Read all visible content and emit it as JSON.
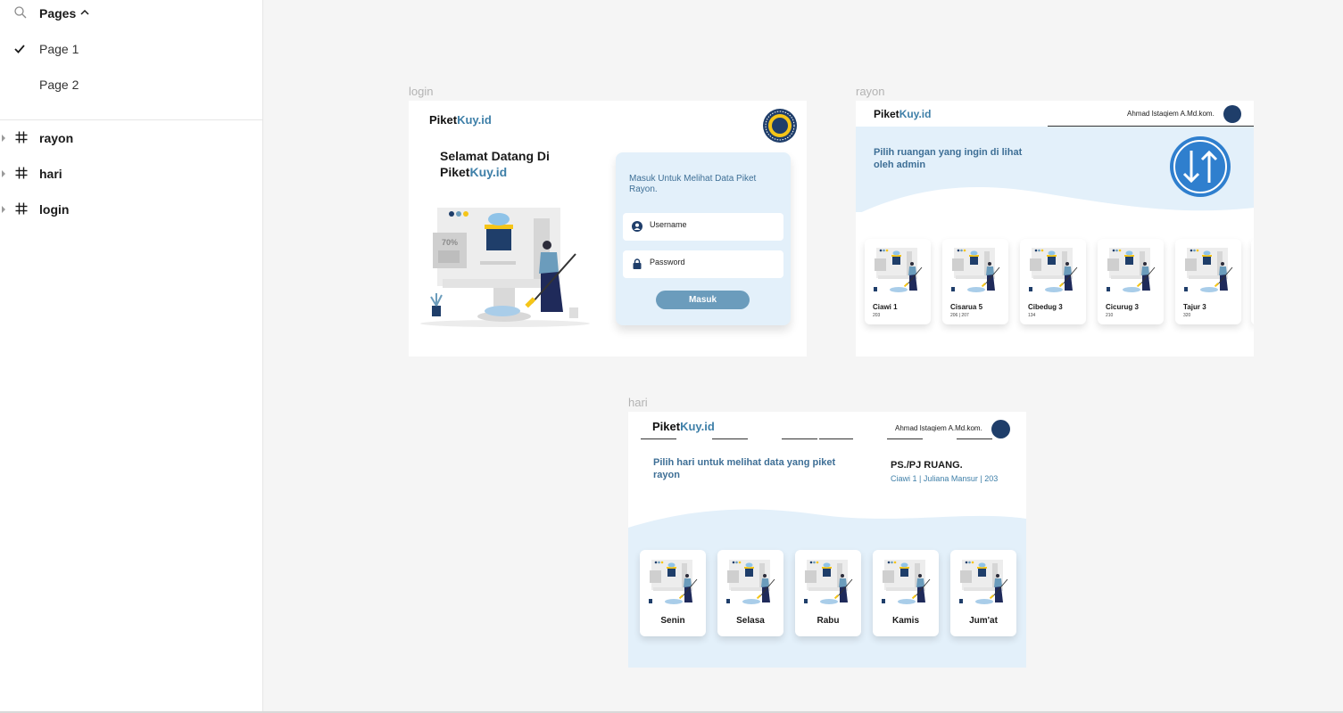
{
  "sidebar": {
    "pages_title": "Pages",
    "pages": [
      {
        "label": "Page 1",
        "selected": true
      },
      {
        "label": "Page 2",
        "selected": false
      }
    ],
    "layers": [
      {
        "label": "rayon"
      },
      {
        "label": "hari"
      },
      {
        "label": "login"
      }
    ]
  },
  "frames": {
    "login": {
      "label": "login",
      "brand_main": "Piket",
      "brand_accent": "Kuy.id",
      "welcome_line1": "Selamat Datang Di",
      "welcome_brand_main": "Piket",
      "welcome_brand_accent": "Kuy.id",
      "card_title": "Masuk Untuk Melihat Data Piket Rayon.",
      "username_placeholder": "Username",
      "password_placeholder": "Password",
      "submit_label": "Masuk",
      "illustration_percent": "70%"
    },
    "rayon": {
      "label": "rayon",
      "brand_main": "Piket",
      "brand_accent": "Kuy.id",
      "user_name": "Ahmad Istaqiem A.Md.kom.",
      "hero_text": "Pilih ruangan yang ingin di lihat oleh admin",
      "cards": [
        {
          "name": "Ciawi 1",
          "sub": "203"
        },
        {
          "name": "Cisarua 5",
          "sub": "206 | 207"
        },
        {
          "name": "Cibedug 3",
          "sub": "134"
        },
        {
          "name": "Cicurug 3",
          "sub": "210"
        },
        {
          "name": "Tajur 3",
          "sub": "320"
        }
      ]
    },
    "hari": {
      "label": "hari",
      "brand_main": "Piket",
      "brand_accent": "Kuy.id",
      "user_name": "Ahmad Istaqiem A.Md.kom.",
      "lead_text": "Pilih hari untuk melihat data yang piket rayon",
      "ps_title": "PS./PJ RUANG.",
      "ps_sub": "Ciawi 1 | Juliana Mansur | 203",
      "days": [
        "Senin",
        "Selasa",
        "Rabu",
        "Kamis",
        "Jum'at"
      ]
    }
  },
  "colors": {
    "accent": "#3e7fa8",
    "light_blue": "#e3f0fa",
    "button": "#6b9cbc",
    "navy": "#1f3e6a",
    "yellow": "#f5c518"
  }
}
